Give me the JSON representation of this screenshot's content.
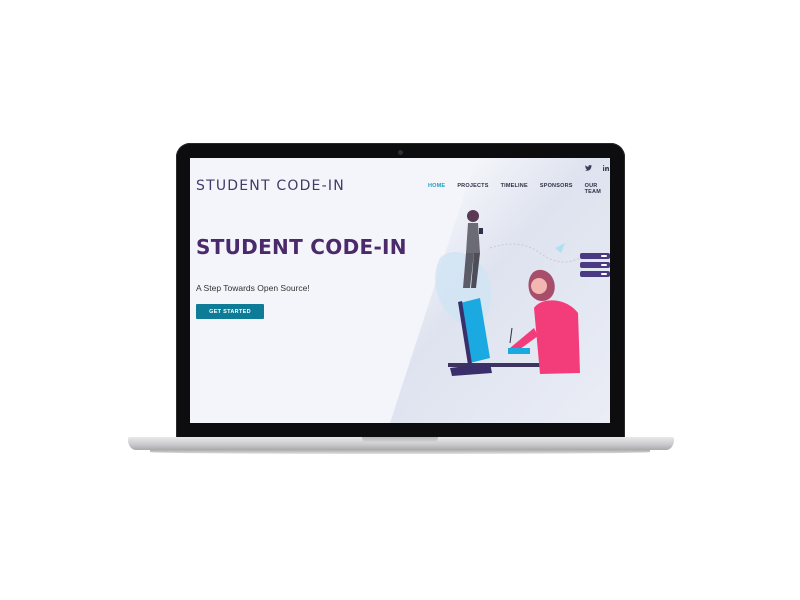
{
  "site": {
    "brand": "STUDENT CODE-IN",
    "nav": [
      {
        "label": "HOME",
        "active": true
      },
      {
        "label": "PROJECTS",
        "active": false
      },
      {
        "label": "TIMELINE",
        "active": false
      },
      {
        "label": "SPONSORS",
        "active": false
      },
      {
        "label": "OUR TEAM",
        "active": false
      }
    ],
    "social": {
      "twitter_icon": "twitter-icon",
      "linkedin_icon": "linkedin-icon"
    },
    "hero": {
      "title": "STUDENT CODE-IN",
      "subtitle": "A Step Towards Open Source!",
      "cta_label": "GET STARTED"
    }
  },
  "colors": {
    "accent": "#1aa1c4",
    "brand_purple": "#4a2a6a",
    "cta_bg": "#0f7c97",
    "screen_bg": "#f4f5fa",
    "illustration_pink": "#f23d7a",
    "illustration_blue": "#1aa9e0"
  }
}
